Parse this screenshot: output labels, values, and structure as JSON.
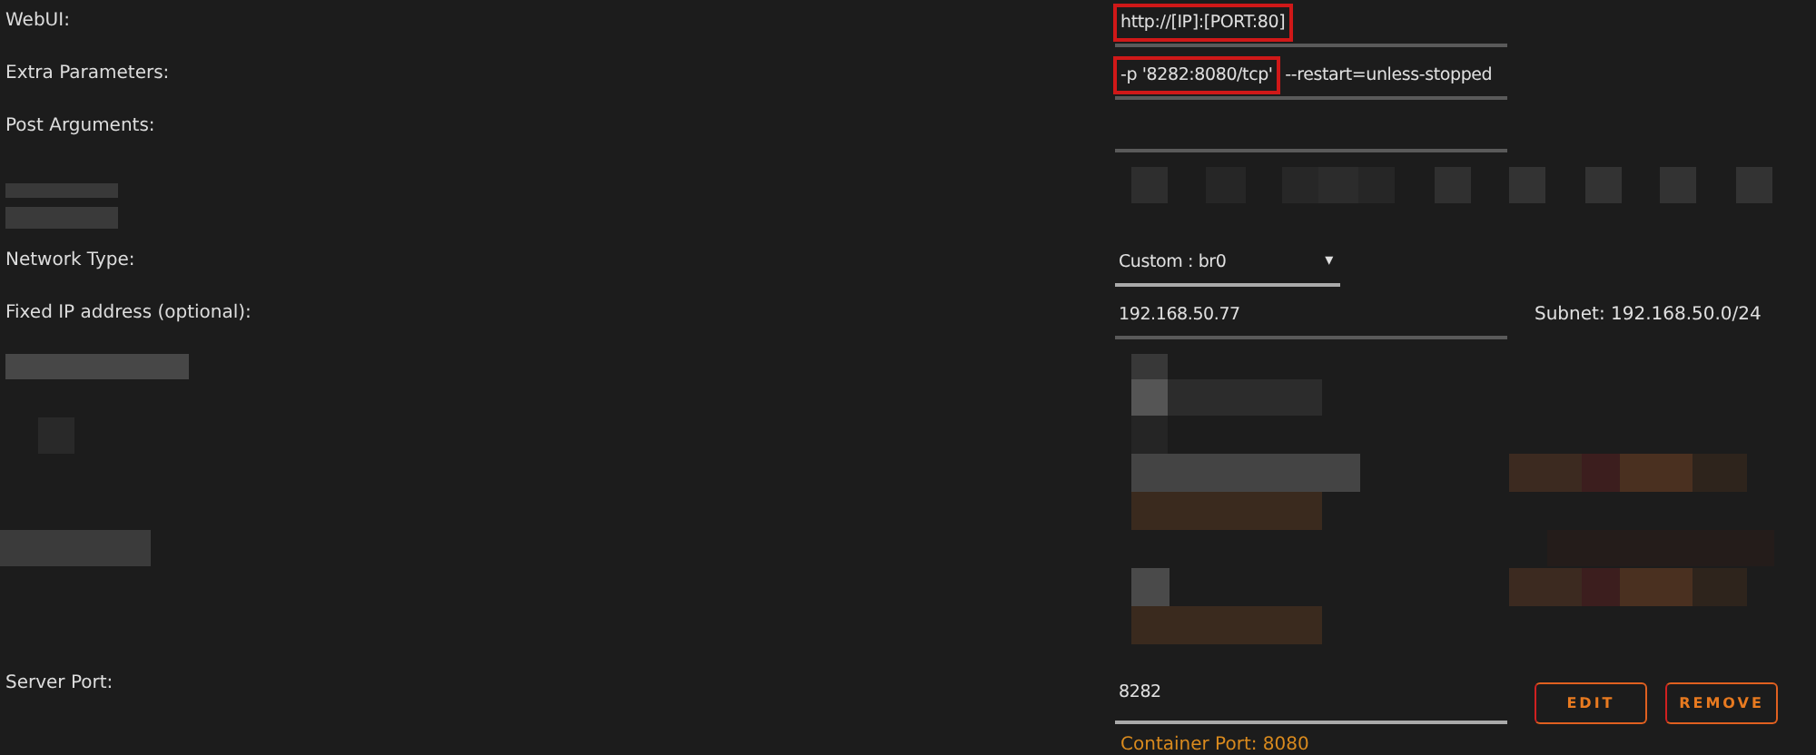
{
  "fields": [
    {
      "label": "WebUI:",
      "kind": "text",
      "value_parts": [
        {
          "text": "http://[IP]:[PORT:80]",
          "highlighted": true
        }
      ]
    },
    {
      "label": "Extra Parameters:",
      "kind": "text",
      "value_parts": [
        {
          "text": "-p '8282:8080/tcp'",
          "highlighted": true
        },
        {
          "text": " --restart=unless-stopped",
          "highlighted": false
        }
      ]
    },
    {
      "label": "Post Arguments:",
      "kind": "text"
    },
    {
      "label": "Network Type:",
      "kind": "select",
      "value": "Custom : br0",
      "caret": "▾"
    },
    {
      "label": "Fixed IP address (optional):",
      "kind": "text",
      "value": "192.168.50.77",
      "note": "Subnet: 192.168.50.0/24"
    }
  ],
  "server_port": {
    "label": "Server Port:",
    "value": "8282",
    "hint": "Container Port: 8080",
    "buttons": [
      "EDIT",
      "REMOVE"
    ]
  }
}
